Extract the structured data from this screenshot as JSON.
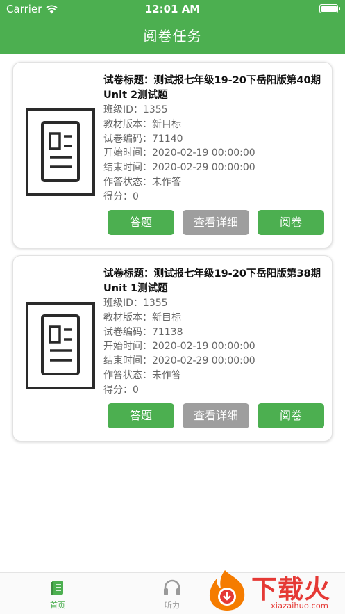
{
  "status_bar": {
    "carrier": "Carrier",
    "time": "12:01 AM"
  },
  "header": {
    "title": "阅卷任务"
  },
  "cards": [
    {
      "title": "试卷标题：测试报七年级19-20下岳阳版第40期Unit 2测试题",
      "class_id": "班级ID：1355",
      "edition": "教材版本：新目标",
      "paper_code": "试卷编码：71140",
      "start_time": "开始时间：2020-02-19 00:00:00",
      "end_time": "结束时间：2020-02-29 00:00:00",
      "answer_status": "作答状态：未作答",
      "score": "得分：0",
      "buttons": {
        "answer": "答题",
        "detail": "查看详细",
        "review": "阅卷"
      }
    },
    {
      "title": "试卷标题：测试报七年级19-20下岳阳版第38期Unit 1测试题",
      "class_id": "班级ID：1355",
      "edition": "教材版本：新目标",
      "paper_code": "试卷编码：71138",
      "start_time": "开始时间：2020-02-19 00:00:00",
      "end_time": "结束时间：2020-02-29 00:00:00",
      "answer_status": "作答状态：未作答",
      "score": "得分：0",
      "buttons": {
        "answer": "答题",
        "detail": "查看详细",
        "review": "阅卷"
      }
    }
  ],
  "tabbar": [
    {
      "label": "首页",
      "icon": "book-icon",
      "active": true
    },
    {
      "label": "听力",
      "icon": "headphones-icon",
      "active": false
    }
  ],
  "watermark": {
    "text": "下载火",
    "subtext": "xiazaihuo.com"
  },
  "colors": {
    "primary": "#4caf50",
    "secondary_button": "#9e9e9e",
    "watermark": "#e53935"
  }
}
